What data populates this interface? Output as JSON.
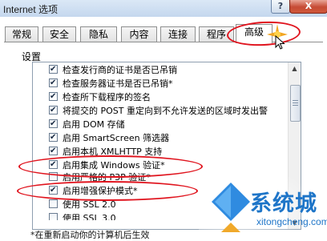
{
  "window": {
    "title": "Internet 选项",
    "help_label": "?",
    "close_label": "X"
  },
  "tabs": [
    {
      "label": "常规",
      "active": false
    },
    {
      "label": "安全",
      "active": false
    },
    {
      "label": "隐私",
      "active": false
    },
    {
      "label": "内容",
      "active": false
    },
    {
      "label": "连接",
      "active": false
    },
    {
      "label": "程序",
      "active": false
    },
    {
      "label": "高级",
      "active": true
    }
  ],
  "settings": {
    "group_label": "设置",
    "items": [
      {
        "label": "检查发行商的证书是否已吊销",
        "checked": true
      },
      {
        "label": "检查服务器证书是否已吊销*",
        "checked": true
      },
      {
        "label": "检查所下载程序的签名",
        "checked": true
      },
      {
        "label": "将提交的 POST 重定向到不允许发送的区域时发出警",
        "checked": true
      },
      {
        "label": "启用 DOM 存储",
        "checked": true
      },
      {
        "label": "启用 SmartScreen 筛选器",
        "checked": true
      },
      {
        "label": "启用本机 XMLHTTP 支持",
        "checked": true
      },
      {
        "label": "启用集成 Windows 验证*",
        "checked": true
      },
      {
        "label": "启用严格的 P3P 验证*",
        "checked": false
      },
      {
        "label": "启用增强保护模式*",
        "checked": true
      },
      {
        "label": "使用 SSL 2.0",
        "checked": false
      },
      {
        "label": "使用 SSL 3.0",
        "checked": false
      }
    ]
  },
  "footnote": "*在重新启动你的计算机后生效",
  "watermark": {
    "brand": "系统城",
    "url": "xitongcheng.com"
  },
  "colors": {
    "annotation": "#e0141e",
    "watermark": "#1e75c8",
    "titlebar": "#c4d7ee"
  }
}
